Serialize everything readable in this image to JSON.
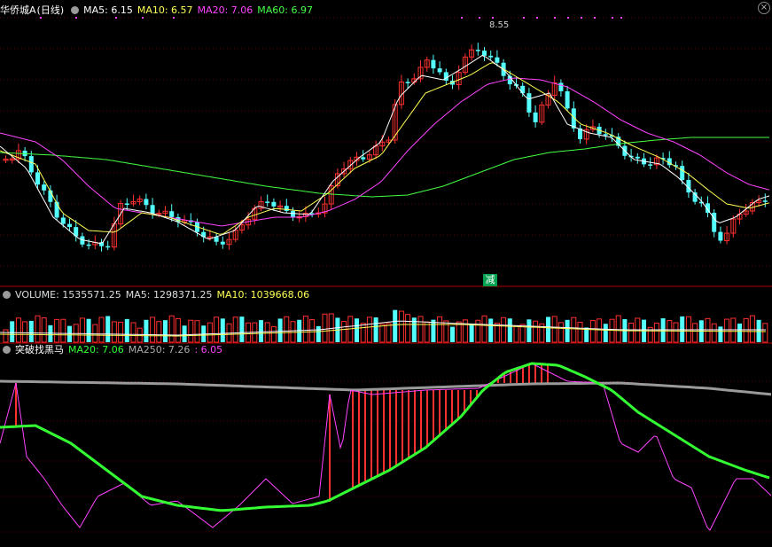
{
  "main_panel": {
    "stock_name": "华侨城A",
    "period": "(日线)",
    "indicators": [
      {
        "label": "MA5: 6.15",
        "color": "#ffffff"
      },
      {
        "label": "MA10: 6.57",
        "color": "#ffff55"
      },
      {
        "label": "MA20: 7.06",
        "color": "#ff44ff"
      },
      {
        "label": "MA60: 6.97",
        "color": "#44ff44"
      }
    ],
    "peak_label": "8.55",
    "reduce_badge": "减"
  },
  "volume_panel": {
    "indicators": [
      {
        "label": "VOLUME: 1535571.25",
        "color": "#dddddd"
      },
      {
        "label": "MA5: 1298371.25",
        "color": "#dddddd"
      },
      {
        "label": "MA10: 1039668.06",
        "color": "#ffff55"
      }
    ]
  },
  "indicator_panel": {
    "name": "突破找黑马",
    "indicators": [
      {
        "label": "MA20: 7.06",
        "color": "#33ff33"
      },
      {
        "label": "MA250: 7.26",
        "color": "#aaaaaa"
      },
      {
        "label": ": 6.05",
        "color": "#ff44ff"
      }
    ]
  },
  "colors": {
    "up": "#ff3030",
    "down": "#54ffff",
    "grid": "#8b0000",
    "ma5": "#ffffff",
    "ma10": "#ffff55",
    "ma20": "#ff44ff",
    "ma60": "#44ff44",
    "ind_green": "#33ff33",
    "ind_gray": "#9a9a9a",
    "ind_magenta": "#ff44ff"
  }
}
